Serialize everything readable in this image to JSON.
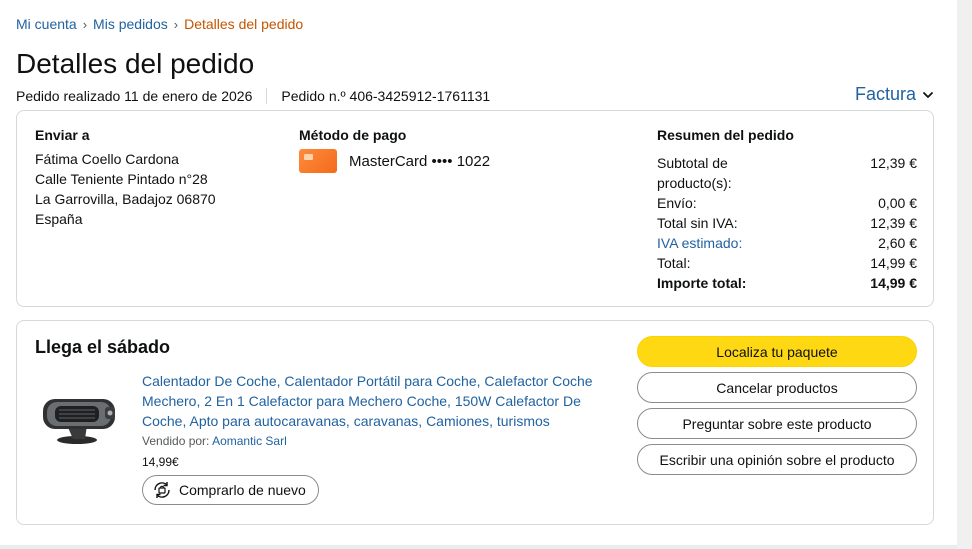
{
  "breadcrumb": {
    "items": [
      "Mi cuenta",
      "Mis pedidos"
    ],
    "current": "Detalles del pedido",
    "separator": "›"
  },
  "page_title": "Detalles del pedido",
  "order_meta": {
    "placed": "Pedido realizado 11 de enero de 2026",
    "number": "Pedido n.º 406-3425912-1761131"
  },
  "invoice_label": "Factura",
  "shipping": {
    "title": "Enviar a",
    "lines": [
      "Fátima Coello Cardona",
      "Calle Teniente Pintado n°28",
      "La Garrovilla, Badajoz 06870",
      "España"
    ]
  },
  "payment": {
    "title": "Método de pago",
    "method": "MasterCard •••• 1022",
    "card_icon": "mastercard-card-icon"
  },
  "summary": {
    "title": "Resumen del pedido",
    "rows": [
      {
        "label": "Subtotal de producto(s):",
        "value": "12,39 €"
      },
      {
        "label": "Envío:",
        "value": "0,00 €"
      },
      {
        "label": "Total sin IVA:",
        "value": "12,39 €"
      },
      {
        "label": "IVA estimado:",
        "value": "2,60 €"
      },
      {
        "label": "Total:",
        "value": "14,99 €"
      },
      {
        "label": "Importe total:",
        "value": "14,99 €"
      }
    ]
  },
  "delivery": {
    "status": "Llega el sábado",
    "product": {
      "title": "Calentador De Coche, Calentador Portátil para Coche, Calefactor Coche Mechero, 2 En 1 Calefactor para Mechero Coche, 150W Calefactor De Coche, Apto para autocaravanas, caravanas, Camiones, turismos",
      "sold_by_label": "Vendido por:",
      "seller": "Aomantic Sarl",
      "price": "14,99€",
      "buy_again": "Comprarlo de nuevo"
    },
    "actions": {
      "track": "Localiza tu paquete",
      "cancel": "Cancelar productos",
      "ask": "Preguntar sobre este producto",
      "review": "Escribir una opinión sobre el producto"
    }
  },
  "colors": {
    "link": "#2162a1",
    "breadcrumb_current": "#c45500",
    "primary_button": "#ffd814",
    "border": "#d5d9d9"
  }
}
